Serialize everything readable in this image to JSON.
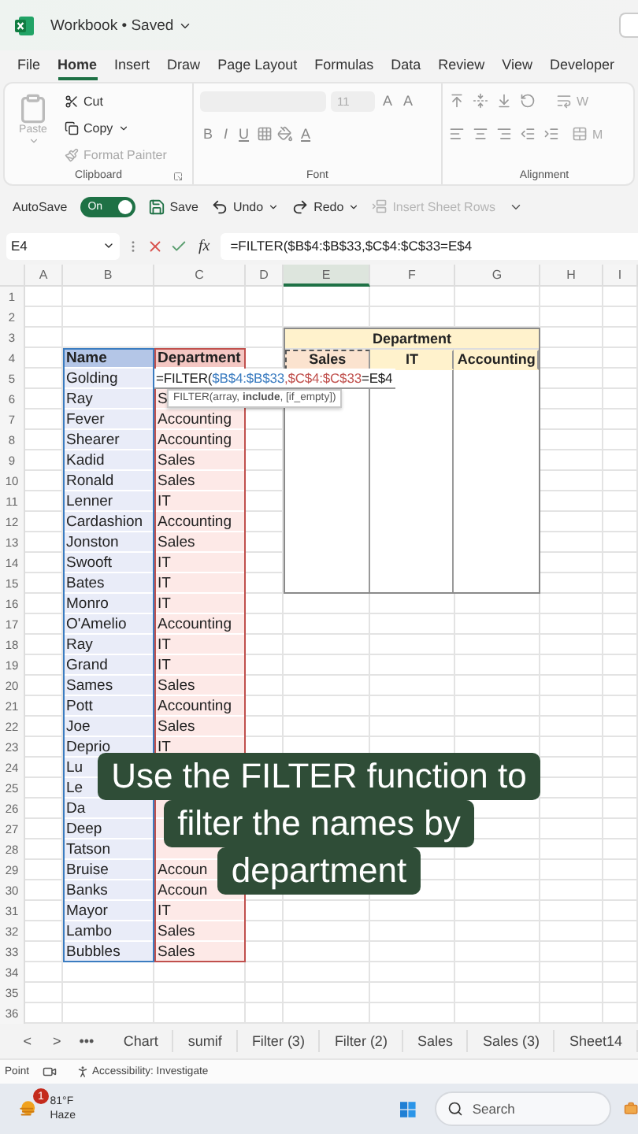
{
  "title_bar": {
    "title": "Workbook • Saved"
  },
  "menu_tabs": [
    {
      "label": "File",
      "selected": false
    },
    {
      "label": "Home",
      "selected": true
    },
    {
      "label": "Insert",
      "selected": false
    },
    {
      "label": "Draw",
      "selected": false
    },
    {
      "label": "Page Layout",
      "selected": false
    },
    {
      "label": "Formulas",
      "selected": false
    },
    {
      "label": "Data",
      "selected": false
    },
    {
      "label": "Review",
      "selected": false
    },
    {
      "label": "View",
      "selected": false
    },
    {
      "label": "Developer",
      "selected": false
    }
  ],
  "ribbon": {
    "clipboard": {
      "paste": "Paste",
      "cut": "Cut",
      "copy": "Copy",
      "format_painter": "Format Painter",
      "label": "Clipboard"
    },
    "font": {
      "size": "11",
      "grow": "A",
      "shrink": "A",
      "bold": "B",
      "italic": "I",
      "underline": "U",
      "font_color": "A",
      "label": "Font"
    },
    "alignment": {
      "wrap": "W",
      "merge": "M",
      "label": "Alignment"
    }
  },
  "quick_access": {
    "autosave": {
      "label": "AutoSave",
      "state": "On",
      "on": true
    },
    "save": "Save",
    "undo": "Undo",
    "redo": "Redo",
    "insert_rows": {
      "label": "Insert Sheet Rows",
      "disabled": true
    }
  },
  "formula_bar": {
    "name_box": "E4",
    "fx": "fx",
    "formula": "=FILTER($B$4:$B$33,$C$4:$C$33=E$4"
  },
  "sheet": {
    "columns": [
      {
        "letter": "A",
        "selected": false
      },
      {
        "letter": "B",
        "selected": false
      },
      {
        "letter": "C",
        "selected": false
      },
      {
        "letter": "D",
        "selected": false
      },
      {
        "letter": "E",
        "selected": true
      },
      {
        "letter": "F",
        "selected": false
      },
      {
        "letter": "G",
        "selected": false
      },
      {
        "letter": "H",
        "selected": false
      },
      {
        "letter": "I",
        "selected": false
      }
    ],
    "row_numbers": [
      "1",
      "2",
      "3",
      "4",
      "5",
      "6",
      "7",
      "8",
      "9",
      "10",
      "11",
      "12",
      "13",
      "14",
      "15",
      "16",
      "17",
      "18",
      "19",
      "20",
      "21",
      "22",
      "23",
      "24",
      "25",
      "26",
      "27",
      "28",
      "29",
      "30",
      "31",
      "32",
      "33",
      "34",
      "35",
      "36"
    ],
    "name_table": {
      "header": {
        "name": "Name",
        "department": "Department"
      },
      "rows": [
        {
          "name": "Golding"
        },
        {
          "name": "Ray",
          "department": "S"
        },
        {
          "name": "Fever",
          "department": "Accounting"
        },
        {
          "name": "Shearer",
          "department": "Accounting"
        },
        {
          "name": "Kadid",
          "department": "Sales"
        },
        {
          "name": "Ronald",
          "department": "Sales"
        },
        {
          "name": "Lenner",
          "department": "IT"
        },
        {
          "name": "Cardashion",
          "department": "Accounting"
        },
        {
          "name": "Jonston",
          "department": "Sales"
        },
        {
          "name": "Swooft",
          "department": "IT"
        },
        {
          "name": "Bates",
          "department": "IT"
        },
        {
          "name": "Monro",
          "department": "IT"
        },
        {
          "name": "O'Amelio",
          "department": "Accounting"
        },
        {
          "name": "Ray",
          "department": "IT"
        },
        {
          "name": "Grand",
          "department": "IT"
        },
        {
          "name": "Sames",
          "department": "Sales"
        },
        {
          "name": "Pott",
          "department": "Accounting"
        },
        {
          "name": "Joe",
          "department": "Sales"
        },
        {
          "name": "Deprio",
          "department": "IT"
        },
        {
          "name": "Lu"
        },
        {
          "name": "Le"
        },
        {
          "name": "Da"
        },
        {
          "name": "Deep"
        },
        {
          "name": "Tatson"
        },
        {
          "name": "Bruise",
          "department": "Accoun"
        },
        {
          "name": "Banks",
          "department": "Accoun"
        },
        {
          "name": "Mayor",
          "department": "IT"
        },
        {
          "name": "Lambo",
          "department": "Sales"
        },
        {
          "name": "Bubbles",
          "department": "Sales"
        }
      ]
    },
    "cell_editor": {
      "parts": [
        {
          "text": "=FILTER(",
          "color": "#222222"
        },
        {
          "text": "$B$4:$B$33",
          "color": "#3b7cc0"
        },
        {
          "text": ",$C$4:$C$33",
          "color": "#c0504d"
        },
        {
          "text": "=E$4",
          "color": "#222222"
        }
      ],
      "tooltip": "FILTER(array, **include**, [if_empty])"
    },
    "department_table": {
      "title": "Department",
      "headers": [
        {
          "label": "Sales",
          "selected": true,
          "color": "#fbe3cf"
        },
        {
          "label": "IT",
          "selected": false,
          "color": "#fff2cc"
        },
        {
          "label": "Accounting",
          "selected": false,
          "color": "#fff2cc"
        }
      ]
    }
  },
  "caption": {
    "lines": [
      "Use the FILTER function to",
      "filter the names by",
      "department"
    ]
  },
  "sheet_tabs": {
    "nav": [
      "<",
      ">",
      "•••"
    ],
    "tabs": [
      {
        "label": "Chart",
        "selected": false
      },
      {
        "label": "sumif",
        "selected": false
      },
      {
        "label": "Filter (3)",
        "selected": false
      },
      {
        "label": "Filter (2)",
        "selected": false
      },
      {
        "label": "Sales",
        "selected": false
      },
      {
        "label": "Sales (3)",
        "selected": false
      },
      {
        "label": "Sheet14",
        "selected": false
      }
    ]
  },
  "status_bar": {
    "mode": "Point",
    "accessibility": "Accessibility: Investigate"
  },
  "taskbar": {
    "badge": "1",
    "temperature": "81°F",
    "condition": "Haze",
    "search": {
      "placeholder": "Search"
    }
  }
}
